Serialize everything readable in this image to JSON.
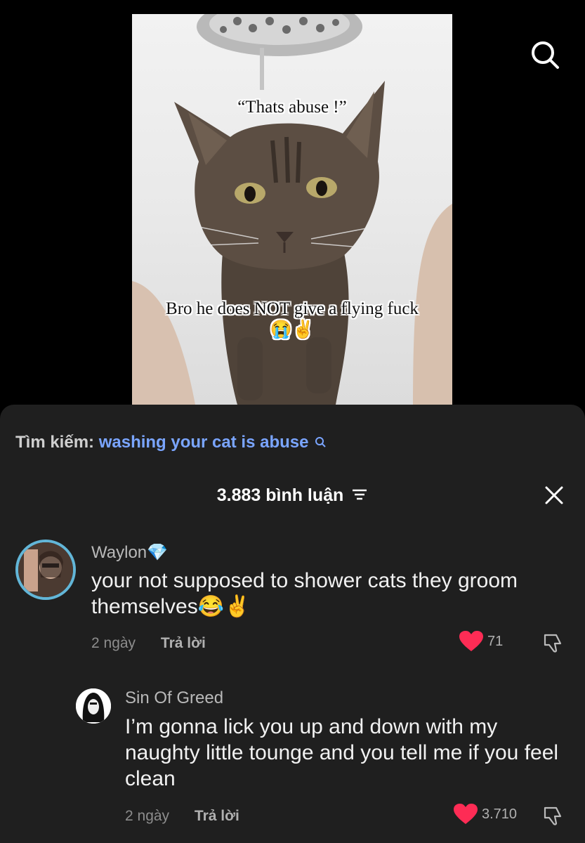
{
  "video": {
    "caption_top": "“Thats abuse !”",
    "caption_bottom": "Bro he does NOT give a flying fuck😭✌️"
  },
  "search": {
    "label": "Tìm kiếm:",
    "query": "washing your cat is abuse"
  },
  "comments_header": {
    "count_label": "3.883 bình luận"
  },
  "comments": [
    {
      "username": "Waylon",
      "badge": "💎",
      "text": "your not supposed to shower cats they groom themselves😂✌️",
      "time": "2 ngày",
      "reply_label": "Trả lời",
      "likes": "71"
    },
    {
      "username": "Sin Of Greed",
      "text": "I’m gonna lick you up and down with my naughty little tounge and you tell me if you feel clean",
      "time": "2 ngày",
      "reply_label": "Trả lời",
      "likes": "3.710"
    }
  ],
  "colors": {
    "background": "#000000",
    "panel": "#1f1f1f",
    "link": "#7aa5ff",
    "heart": "#fe2c55",
    "avatar_ring": "#62b6d8"
  }
}
